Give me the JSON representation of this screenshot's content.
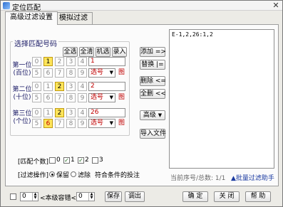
{
  "window": {
    "title": "定位匹配",
    "close": "✕"
  },
  "tabs": [
    {
      "label": "高级过滤设置"
    },
    {
      "label": "模拟过滤"
    }
  ],
  "select_group": {
    "title": "选择匹配号码",
    "buttons": {
      "all": "全选",
      "clear": "全清",
      "random": "机选",
      "enter": "录入"
    },
    "rows": [
      {
        "label_line1": "第一位",
        "label_line2": "(百位)",
        "top": [
          "0",
          "1",
          "2",
          "3",
          "4"
        ],
        "bottom": [
          "5",
          "6",
          "7",
          "8",
          "9"
        ],
        "selected": [
          "1"
        ],
        "input": "1",
        "select": "选号"
      },
      {
        "label_line1": "第二位",
        "label_line2": "(十位)",
        "top": [
          "0",
          "1",
          "2",
          "3",
          "4"
        ],
        "bottom": [
          "5",
          "6",
          "7",
          "8",
          "9"
        ],
        "selected": [
          "2"
        ],
        "input": "2",
        "select": "选号"
      },
      {
        "label_line1": "第三位",
        "label_line2": "(个位)",
        "top": [
          "0",
          "1",
          "2",
          "3",
          "4"
        ],
        "bottom": [
          "5",
          "6",
          "7",
          "8",
          "9"
        ],
        "selected": [
          "2",
          "6"
        ],
        "input": "26",
        "select": "选号"
      }
    ],
    "image_icon": "图"
  },
  "actions": {
    "add": "添加 =>",
    "replace": "替换 |=",
    "delete": "删除 <=",
    "delete_all": "全删 <<",
    "advanced": "高级",
    "import": "导入文件"
  },
  "conditions_text": "E-1,2,26:1,2",
  "match_count": {
    "label": "[匹配个数]",
    "options": [
      "0",
      "1",
      "2",
      "3"
    ],
    "checked": [
      "1",
      "2"
    ]
  },
  "filter_op": {
    "label": "[过滤操作]",
    "keep": "保留",
    "remove": "滤除",
    "suffix": "符合条件的投注"
  },
  "status": {
    "current": "当前序号/总数: 1/1",
    "batch_link": "▲批量过滤助手"
  },
  "bottom": {
    "spin1": "0",
    "tolerance_label": "<本级容错<",
    "spin2": "0",
    "save": "保存",
    "load": "调出",
    "ok": "确 定",
    "close": "关 闭",
    "help": "帮 助"
  }
}
